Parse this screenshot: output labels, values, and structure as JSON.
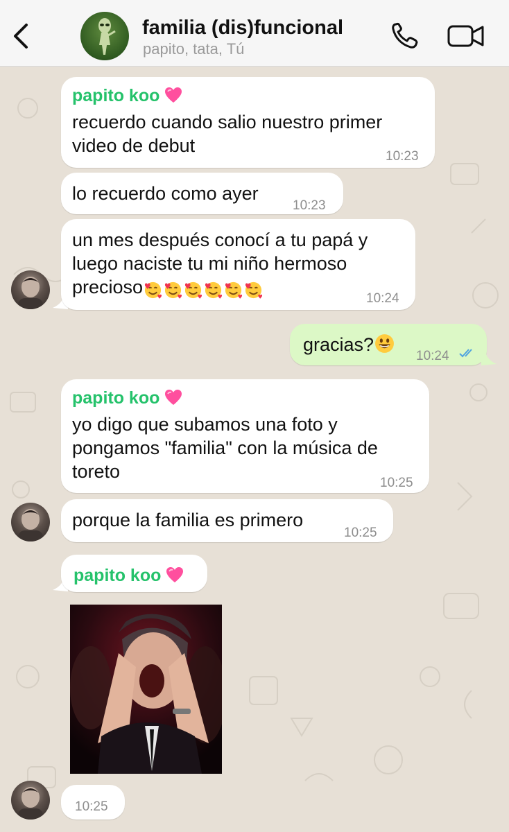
{
  "header": {
    "title": "familia (dis)funcional",
    "subtitle": "papito, tata, Tú"
  },
  "messages": [
    {
      "sender": "papito koo",
      "text": "recuerdo cuando salio nuestro primer\nvideo de debut",
      "time": "10:23"
    },
    {
      "text": "lo recuerdo como ayer",
      "time": "10:23"
    },
    {
      "text_line1": "un mes después conocí a tu papá y",
      "text_line2": "luego naciste tu mi niño hermoso",
      "text_line3": "precioso",
      "time": "10:24",
      "emoji": "smiling-face-with-hearts x6"
    },
    {
      "text": "gracias?",
      "time": "10:24",
      "direction": "outgoing",
      "status": "read"
    },
    {
      "sender": "papito koo",
      "text": "yo digo que subamos una foto y\npongamos \"familia\" con la música de\ntoreto",
      "time": "10:25"
    },
    {
      "text": "porque la familia es primero",
      "time": "10:25"
    },
    {
      "sender": "papito koo",
      "type": "photo"
    },
    {
      "time": "10:25"
    }
  ],
  "colors": {
    "sender_name": "#25c26b",
    "outgoing_bubble": "#dcf8c6",
    "incoming_bubble": "#ffffff",
    "read_ticks": "#4fa3e0",
    "chat_background": "#e7e0d6"
  },
  "icons": {
    "back": "chevron-left-icon",
    "call": "phone-icon",
    "video": "video-camera-icon"
  }
}
